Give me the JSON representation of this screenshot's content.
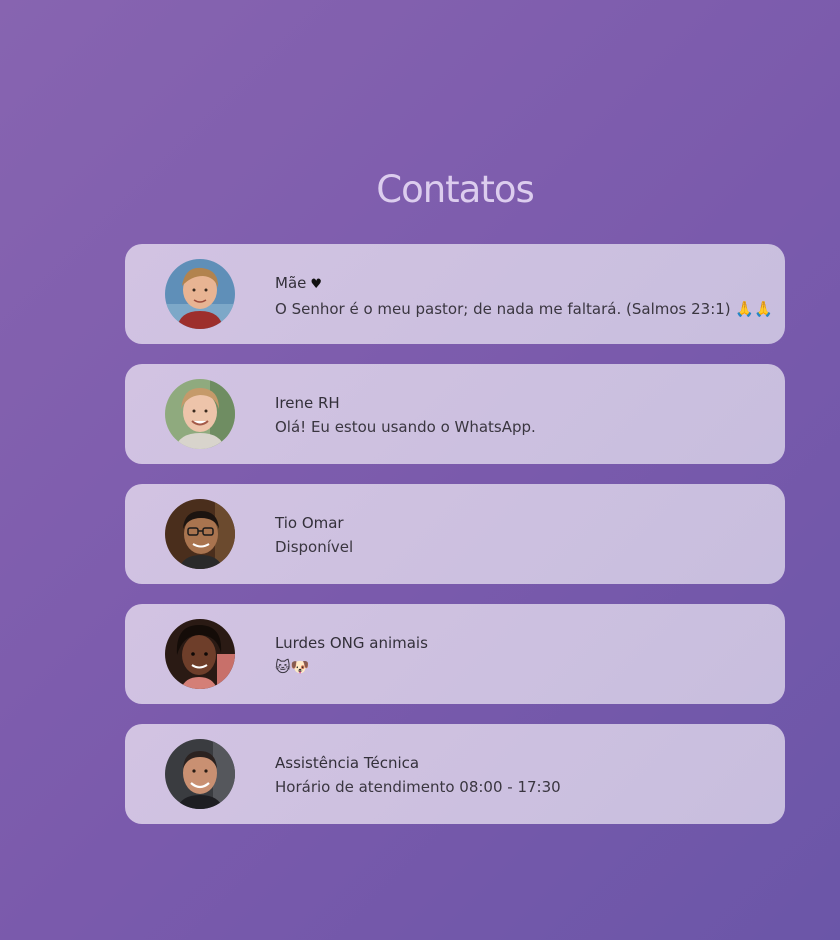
{
  "page": {
    "title": "Contatos"
  },
  "contacts": [
    {
      "name": "Mãe",
      "name_icon": "heart-icon",
      "name_icon_glyph": "♥",
      "status": "O Senhor é o meu pastor; de nada me faltará. (Salmos 23:1) 🙏🙏",
      "avatar": "avatar-woman-short-hair"
    },
    {
      "name": "Irene RH",
      "status": "Olá! Eu estou usando o WhatsApp.",
      "avatar": "avatar-woman-smiling"
    },
    {
      "name": "Tio Omar",
      "status": "Disponível",
      "avatar": "avatar-man-glasses"
    },
    {
      "name": "Lurdes ONG animais",
      "status": "🐱🐶",
      "avatar": "avatar-woman-dark-hair"
    },
    {
      "name": "Assistência Técnica",
      "status": "Horário de atendimento 08:00 - 17:30",
      "avatar": "avatar-man-bald"
    }
  ],
  "colors": {
    "background_start": "#8764b0",
    "background_end": "#6b56a8",
    "card": "#cfc2e2",
    "title": "#dccdee"
  }
}
